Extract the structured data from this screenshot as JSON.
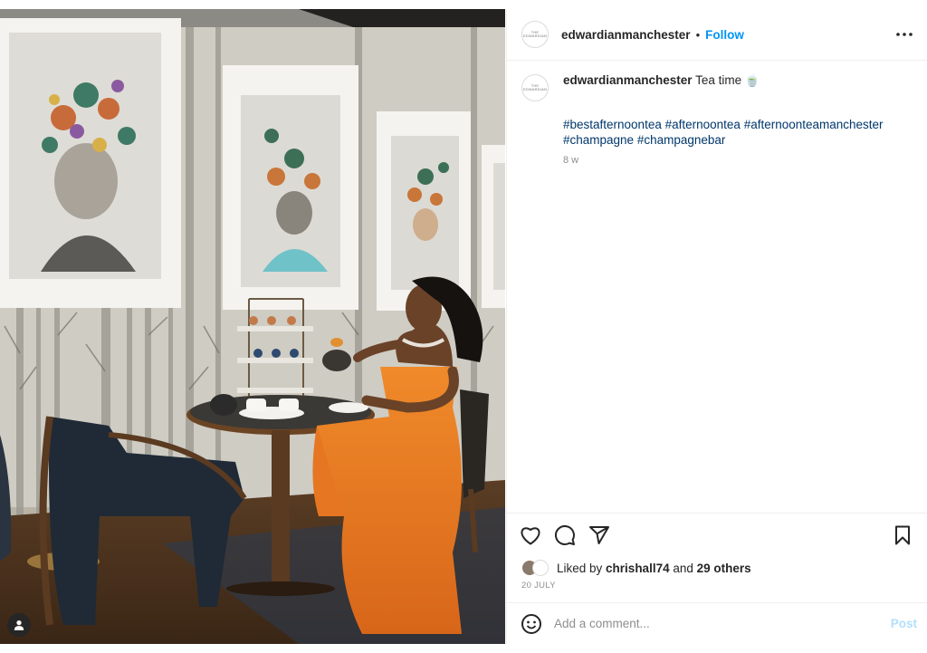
{
  "post": {
    "username": "edwardianmanchester",
    "separator": "•",
    "follow_label": "Follow",
    "avatar_logo_text": "THE EDWARDIAN",
    "caption": {
      "username": "edwardianmanchester",
      "text": " Tea time 🍵",
      "hashtags": [
        "#bestafternoontea",
        "#afternoontea",
        "#afternoonteamanchester",
        "#champagne",
        "#champagnebar"
      ],
      "time": "8 w"
    },
    "likes": {
      "prefix": "Liked by ",
      "user": "chrishall74",
      "middle": " and ",
      "others": "29 others"
    },
    "date": "20 JULY",
    "comment": {
      "placeholder": "Add a comment...",
      "post_label": "Post"
    },
    "icons": {
      "more": "more-options-icon",
      "like": "heart-icon",
      "comment": "comment-icon",
      "share": "share-icon",
      "save": "bookmark-icon",
      "emoji": "emoji-icon",
      "tag": "user-tag-icon"
    }
  }
}
